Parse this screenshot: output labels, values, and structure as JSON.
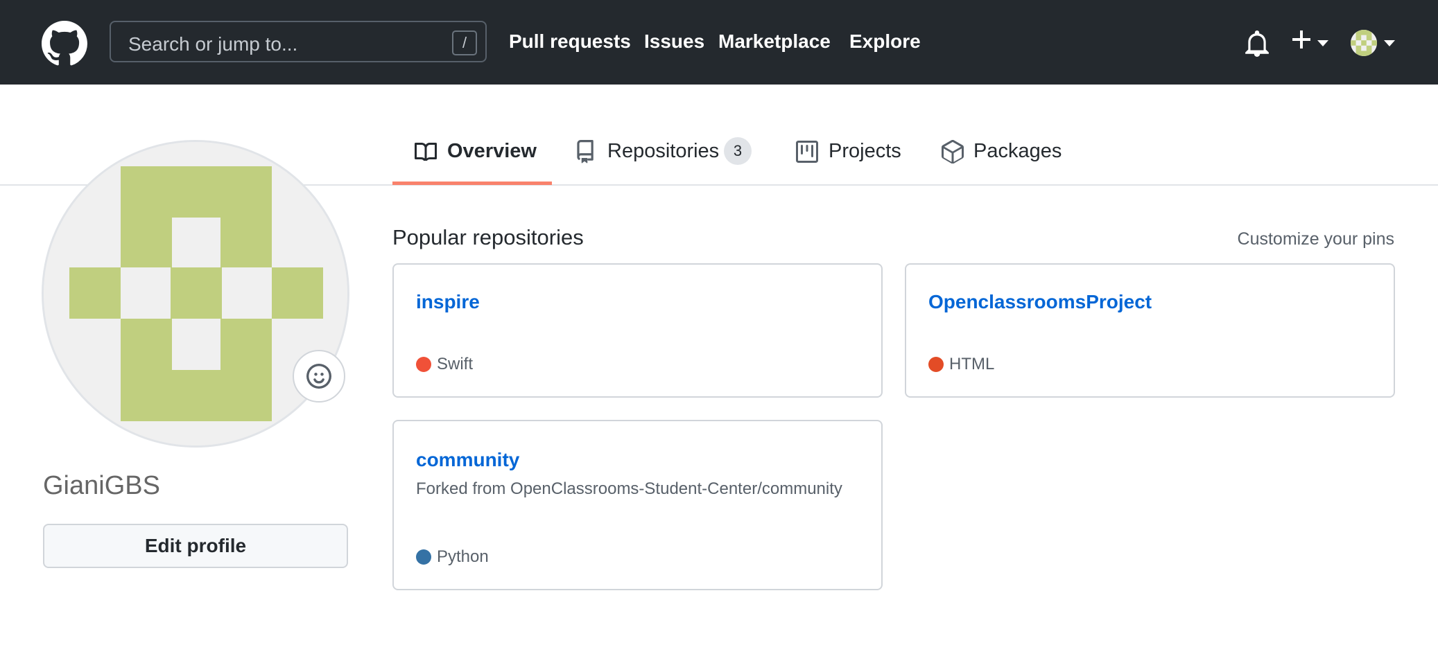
{
  "header": {
    "search_placeholder": "Search or jump to...",
    "search_shortcut": "/",
    "nav": [
      "Pull requests",
      "Issues",
      "Marketplace",
      "Explore"
    ]
  },
  "tabs": [
    {
      "label": "Overview",
      "active": true
    },
    {
      "label": "Repositories",
      "count": "3"
    },
    {
      "label": "Projects"
    },
    {
      "label": "Packages"
    }
  ],
  "profile": {
    "username": "GianiGBS",
    "edit_label": "Edit profile"
  },
  "popular": {
    "title": "Popular repositories",
    "customize_label": "Customize your pins",
    "repos": [
      {
        "name": "inspire",
        "description": "",
        "language": "Swift",
        "color": "#f05138"
      },
      {
        "name": "OpenclassroomsProject",
        "description": "",
        "language": "HTML",
        "color": "#e34c26"
      },
      {
        "name": "community",
        "description": "Forked from OpenClassrooms-Student-Center/community",
        "language": "Python",
        "color": "#3572a5"
      }
    ]
  },
  "colors": {
    "header_bg": "#24292e",
    "link": "#0366d6",
    "tab_active": "#f9826c",
    "avatar": "#c0cf7f"
  }
}
